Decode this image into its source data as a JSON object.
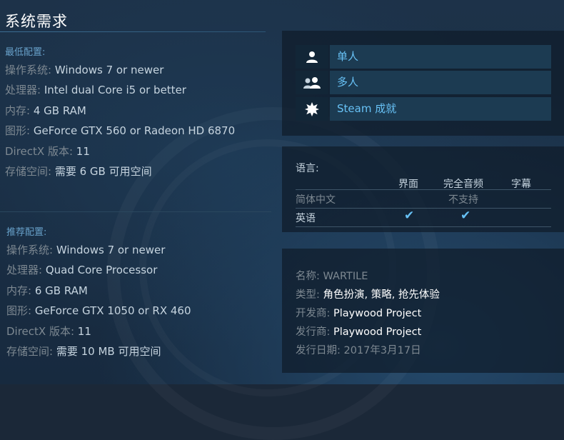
{
  "title": "系统需求",
  "minimum": {
    "heading": "最低配置:",
    "rows": [
      {
        "key": "操作系统:",
        "value": "Windows 7 or newer"
      },
      {
        "key": "处理器:",
        "value": "Intel dual Core i5 or better"
      },
      {
        "key": "内存:",
        "value": "4 GB RAM"
      },
      {
        "key": "图形:",
        "value": "GeForce GTX 560 or Radeon HD 6870"
      },
      {
        "key": "DirectX 版本:",
        "value": "11"
      },
      {
        "key": "存储空间:",
        "value": "需要 6 GB 可用空间"
      }
    ]
  },
  "recommended": {
    "heading": "推荐配置:",
    "rows": [
      {
        "key": "操作系统:",
        "value": "Windows 7 or newer"
      },
      {
        "key": "处理器:",
        "value": "Quad Core Processor"
      },
      {
        "key": "内存:",
        "value": "6 GB RAM"
      },
      {
        "key": "图形:",
        "value": "GeForce GTX 1050 or RX 460"
      },
      {
        "key": "DirectX 版本:",
        "value": "11"
      },
      {
        "key": "存储空间:",
        "value": "需要 10 MB 可用空间"
      }
    ]
  },
  "features": [
    {
      "label": "单人",
      "icon": "single-player-icon"
    },
    {
      "label": "多人",
      "icon": "multi-player-icon"
    },
    {
      "label": "Steam 成就",
      "icon": "achievement-icon"
    }
  ],
  "languages": {
    "title": "语言:",
    "headers": [
      "界面",
      "完全音频",
      "字幕"
    ],
    "rows": [
      {
        "name": "简体中文",
        "note": "不支持"
      },
      {
        "name": "英语",
        "interface": true,
        "audio": true,
        "subtitles": false
      }
    ],
    "check_glyph": "✔"
  },
  "details": {
    "name_label": "名称:",
    "name": "WARTILE",
    "genre_label": "类型:",
    "genre": "角色扮演, 策略, 抢先体验",
    "developer_label": "开发商:",
    "developer": "Playwood Project",
    "publisher_label": "发行商:",
    "publisher": "Playwood Project",
    "release_label": "发行日期:",
    "release": "2017年3月17日"
  },
  "colors": {
    "link": "#67c1f5",
    "heading": "#67a0c9"
  }
}
